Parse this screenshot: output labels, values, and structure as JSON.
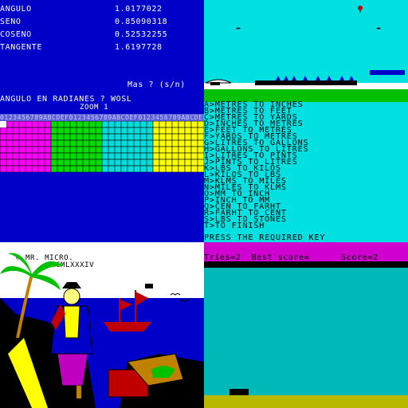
{
  "trig": {
    "rows": [
      {
        "name": "ANGULO",
        "value": "1.0177022"
      },
      {
        "name": "SENO",
        "value": "0.85090318"
      },
      {
        "name": "COSENO",
        "value": "0.52532255"
      },
      {
        "name": "TANGENTE",
        "value": "1.6197728"
      }
    ],
    "prompt_more": "Mas ? (s/n)",
    "prompt_radians": "ANGULO EN RADIANES ? WOSL"
  },
  "grid": {
    "title": "ZOOM 1",
    "header": "0123456789ABCDEF0123456789ABCDEF0123456789ABCDEF",
    "colors": [
      "#ff00ff",
      "#00e000",
      "#00e0e0",
      "#ffff00"
    ]
  },
  "converter": {
    "items": [
      "A>METRES TO INCHES",
      "B>METRES TO FEET",
      "C>METRES TO YARDS",
      "D>INCHES TO METRES",
      "E>FEET TO METRES",
      "F>YARDS TO METRES",
      "G>LITRES TO GALLONS",
      "H>GALLONS TO LITRES",
      "I>LITRES TO PINTS",
      "J>PINTS TO LITRES",
      "K>LBS TO KILOS",
      "L>KILOS TO LBS",
      "M>KLMS TO MILES",
      "N>MILES TO KLMS",
      "O>MM TO INCH",
      "P>INCH TO MM",
      "Q>CEN TO FARHT",
      "R>FARHT TO CENT",
      "S>LBS TO STONES",
      "T>TO FINISH"
    ],
    "press": "PRESS THE REQUIRED KEY"
  },
  "pirate": {
    "copyright1": "© MR. MICRO.",
    "copyright2": "MCMLXXXIV"
  },
  "game": {
    "status": "Tries=2  Best score=      Score=2"
  }
}
